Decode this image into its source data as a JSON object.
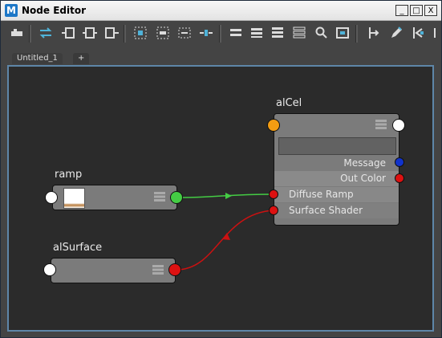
{
  "window": {
    "title": "Node Editor",
    "app_icon": "maya-icon",
    "controls": {
      "minimize": "_",
      "maximize": "□",
      "close": "X"
    }
  },
  "toolbar": {
    "icons": [
      "graph-input-output-icon",
      "swap-arrows-icon",
      "input-connections-icon",
      "input-output-connections-icon",
      "output-connections-icon",
      "frame-all-icon",
      "frame-selected-icon",
      "clear-graph-icon",
      "layout-icon",
      "simple-mode-icon",
      "connected-mode-icon",
      "full-mode-icon",
      "custom-mode-icon",
      "search-icon",
      "graph-snapshot-icon",
      "pin-icon",
      "edit-icon",
      "bookmark-icon"
    ]
  },
  "tabs": [
    {
      "label": "Untitled_1"
    },
    {
      "label": "+"
    }
  ],
  "nodes": {
    "alcel": {
      "label": "alCel",
      "attributes": [
        {
          "label": "Message",
          "port_color": "#1133cc"
        },
        {
          "label": "Out Color",
          "port_color": "#dd1111"
        },
        {
          "label": "Diffuse Ramp",
          "port_color": "#dd1111"
        },
        {
          "label": "Surface Shader",
          "port_color": "#dd1111"
        }
      ],
      "input_port_color": "#f39c12",
      "output_port_color": "#ffffff"
    },
    "ramp": {
      "label": "ramp",
      "output_port_color": "#44cc44"
    },
    "alsurface": {
      "label": "alSurface",
      "output_port_color": "#dd1111"
    }
  },
  "connections": [
    {
      "from": "ramp.outColor",
      "to": "alCel.Diffuse Ramp",
      "color": "#44cc44"
    },
    {
      "from": "alSurface.outColor",
      "to": "alCel.Surface Shader",
      "color": "#cc1111"
    }
  ]
}
